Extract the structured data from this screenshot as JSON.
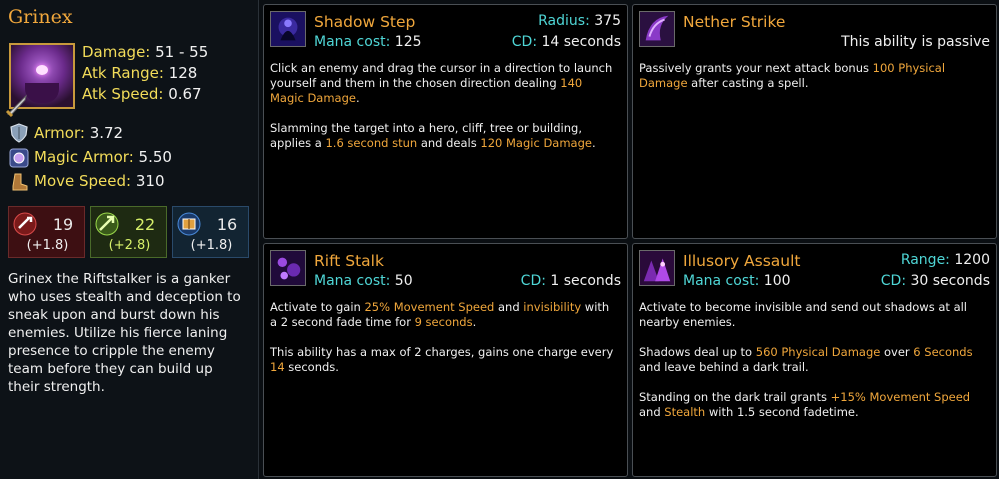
{
  "hero": {
    "name": "Grinex",
    "stats": [
      {
        "label": "Damage:",
        "value": "51 - 55"
      },
      {
        "label": "Atk Range:",
        "value": "128"
      },
      {
        "label": "Atk Speed:",
        "value": "0.67"
      },
      {
        "label": "Armor:",
        "value": "3.72"
      },
      {
        "label": "Magic Armor:",
        "value": "5.50"
      },
      {
        "label": "Move Speed:",
        "value": "310"
      }
    ],
    "attributes": {
      "strength": {
        "base": "19",
        "gain": "(+1.8)",
        "color": "#3d0f12"
      },
      "agility": {
        "base": "22",
        "gain": "(+2.8)",
        "color": "#1e2a12"
      },
      "intelligence": {
        "base": "16",
        "gain": "(+1.8)",
        "color": "#122432"
      }
    },
    "lore": "Grinex the Riftstalker is a ganker who uses stealth and deception to sneak upon and burst down his enemies. Utilize his fierce laning presence to cripple the enemy team before they can build up their strength."
  },
  "abilities": [
    {
      "name": "Shadow Step",
      "icon": "shadow-step-icon",
      "mana_label": "Mana cost:",
      "mana_value": "125",
      "top_right_label": "Radius:",
      "top_right_value": "375",
      "cd_label": "CD:",
      "cd_value": "14 seconds",
      "desc": [
        [
          {
            "t": "Click an enemy and drag the cursor in a direction to launch yourself and them in the chosen direction dealing "
          },
          {
            "t": "140 Magic Damage",
            "h": true
          },
          {
            "t": "."
          }
        ],
        [
          {
            "t": "Slamming the target into a hero, cliff, tree or building, applies a "
          },
          {
            "t": "1.6 second stun",
            "h": true
          },
          {
            "t": " and deals "
          },
          {
            "t": "120 Magic Damage",
            "h": true
          },
          {
            "t": "."
          }
        ]
      ]
    },
    {
      "name": "Nether Strike",
      "icon": "nether-strike-icon",
      "passive_text": "This ability is passive",
      "desc": [
        [
          {
            "t": "Passively grants your next attack bonus "
          },
          {
            "t": "100 Physical Damage",
            "h": true
          },
          {
            "t": " after casting a spell."
          }
        ]
      ]
    },
    {
      "name": "Rift Stalk",
      "icon": "rift-stalk-icon",
      "mana_label": "Mana cost:",
      "mana_value": "50",
      "cd_label": "CD:",
      "cd_value": "1 seconds",
      "desc": [
        [
          {
            "t": "Activate to gain "
          },
          {
            "t": "25% Movement Speed",
            "h": true
          },
          {
            "t": " and "
          },
          {
            "t": "invisibility",
            "h": true
          },
          {
            "t": " with a 2 second fade time for "
          },
          {
            "t": "9 seconds",
            "h": true
          },
          {
            "t": "."
          }
        ],
        [
          {
            "t": "This ability has a max of 2 charges, gains one charge every "
          },
          {
            "t": "14",
            "h": true
          },
          {
            "t": " seconds."
          }
        ]
      ]
    },
    {
      "name": "Illusory Assault",
      "icon": "illusory-assault-icon",
      "mana_label": "Mana cost:",
      "mana_value": "100",
      "top_right_label": "Range:",
      "top_right_value": "1200",
      "cd_label": "CD:",
      "cd_value": "30 seconds",
      "desc": [
        [
          {
            "t": "Activate to become invisible and send out shadows at all nearby enemies."
          }
        ],
        [
          {
            "t": "Shadows deal up to "
          },
          {
            "t": "560 Physical Damage",
            "h": true
          },
          {
            "t": " over "
          },
          {
            "t": "6 Seconds",
            "h": true
          },
          {
            "t": " and leave behind a dark trail."
          }
        ],
        [
          {
            "t": "Standing on the dark trail grants "
          },
          {
            "t": "+15% Movement Speed",
            "h": true
          },
          {
            "t": " and "
          },
          {
            "t": "Stealth",
            "h": true
          },
          {
            "t": " with 1.5 second fadetime."
          }
        ]
      ]
    }
  ],
  "colors": {
    "accent": "#f0a73c",
    "label": "#f2dc5a",
    "cyan": "#4fd6d6"
  }
}
